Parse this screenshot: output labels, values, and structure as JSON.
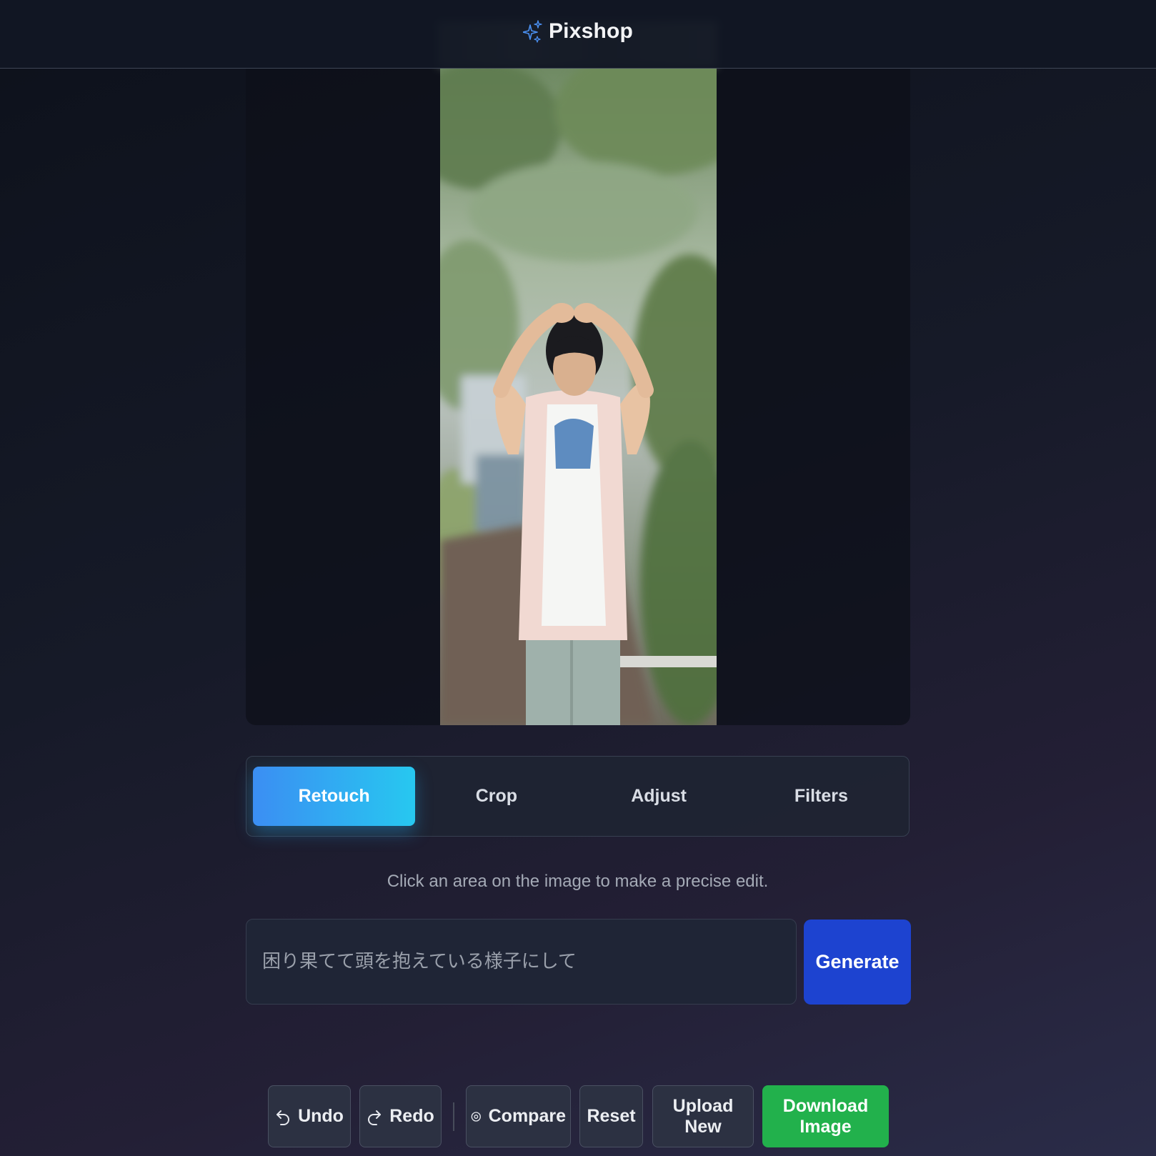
{
  "app": {
    "name": "Pixshop",
    "icon": "sparkles-icon",
    "accent_color": "#3b8ef3"
  },
  "image": {
    "description_label": "photo"
  },
  "tabs": [
    {
      "label": "Retouch",
      "active": true
    },
    {
      "label": "Crop",
      "active": false
    },
    {
      "label": "Adjust",
      "active": false
    },
    {
      "label": "Filters",
      "active": false
    }
  ],
  "hint": "Click an area on the image to make a precise edit.",
  "prompt": {
    "placeholder": "困り果てて頭を抱えている様子にして",
    "value": ""
  },
  "generate_label": "Generate",
  "actions": {
    "undo": {
      "label": "Undo",
      "icon": "undo-icon"
    },
    "redo": {
      "label": "Redo",
      "icon": "redo-icon"
    },
    "compare": {
      "label": "Compare",
      "icon": "eye-icon"
    },
    "reset": {
      "label": "Reset"
    },
    "upload": {
      "label": "Upload New"
    },
    "download": {
      "label": "Download Image",
      "color": "#22b14c"
    }
  }
}
